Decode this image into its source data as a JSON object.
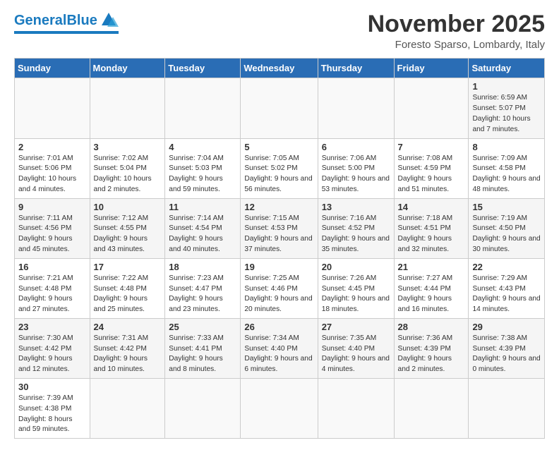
{
  "header": {
    "logo_general": "General",
    "logo_blue": "Blue",
    "month_title": "November 2025",
    "location": "Foresto Sparso, Lombardy, Italy"
  },
  "weekdays": [
    "Sunday",
    "Monday",
    "Tuesday",
    "Wednesday",
    "Thursday",
    "Friday",
    "Saturday"
  ],
  "weeks": [
    [
      {
        "day": "",
        "info": ""
      },
      {
        "day": "",
        "info": ""
      },
      {
        "day": "",
        "info": ""
      },
      {
        "day": "",
        "info": ""
      },
      {
        "day": "",
        "info": ""
      },
      {
        "day": "",
        "info": ""
      },
      {
        "day": "1",
        "info": "Sunrise: 6:59 AM\nSunset: 5:07 PM\nDaylight: 10 hours and 7 minutes."
      }
    ],
    [
      {
        "day": "2",
        "info": "Sunrise: 7:01 AM\nSunset: 5:06 PM\nDaylight: 10 hours and 4 minutes."
      },
      {
        "day": "3",
        "info": "Sunrise: 7:02 AM\nSunset: 5:04 PM\nDaylight: 10 hours and 2 minutes."
      },
      {
        "day": "4",
        "info": "Sunrise: 7:04 AM\nSunset: 5:03 PM\nDaylight: 9 hours and 59 minutes."
      },
      {
        "day": "5",
        "info": "Sunrise: 7:05 AM\nSunset: 5:02 PM\nDaylight: 9 hours and 56 minutes."
      },
      {
        "day": "6",
        "info": "Sunrise: 7:06 AM\nSunset: 5:00 PM\nDaylight: 9 hours and 53 minutes."
      },
      {
        "day": "7",
        "info": "Sunrise: 7:08 AM\nSunset: 4:59 PM\nDaylight: 9 hours and 51 minutes."
      },
      {
        "day": "8",
        "info": "Sunrise: 7:09 AM\nSunset: 4:58 PM\nDaylight: 9 hours and 48 minutes."
      }
    ],
    [
      {
        "day": "9",
        "info": "Sunrise: 7:11 AM\nSunset: 4:56 PM\nDaylight: 9 hours and 45 minutes."
      },
      {
        "day": "10",
        "info": "Sunrise: 7:12 AM\nSunset: 4:55 PM\nDaylight: 9 hours and 43 minutes."
      },
      {
        "day": "11",
        "info": "Sunrise: 7:14 AM\nSunset: 4:54 PM\nDaylight: 9 hours and 40 minutes."
      },
      {
        "day": "12",
        "info": "Sunrise: 7:15 AM\nSunset: 4:53 PM\nDaylight: 9 hours and 37 minutes."
      },
      {
        "day": "13",
        "info": "Sunrise: 7:16 AM\nSunset: 4:52 PM\nDaylight: 9 hours and 35 minutes."
      },
      {
        "day": "14",
        "info": "Sunrise: 7:18 AM\nSunset: 4:51 PM\nDaylight: 9 hours and 32 minutes."
      },
      {
        "day": "15",
        "info": "Sunrise: 7:19 AM\nSunset: 4:50 PM\nDaylight: 9 hours and 30 minutes."
      }
    ],
    [
      {
        "day": "16",
        "info": "Sunrise: 7:21 AM\nSunset: 4:48 PM\nDaylight: 9 hours and 27 minutes."
      },
      {
        "day": "17",
        "info": "Sunrise: 7:22 AM\nSunset: 4:48 PM\nDaylight: 9 hours and 25 minutes."
      },
      {
        "day": "18",
        "info": "Sunrise: 7:23 AM\nSunset: 4:47 PM\nDaylight: 9 hours and 23 minutes."
      },
      {
        "day": "19",
        "info": "Sunrise: 7:25 AM\nSunset: 4:46 PM\nDaylight: 9 hours and 20 minutes."
      },
      {
        "day": "20",
        "info": "Sunrise: 7:26 AM\nSunset: 4:45 PM\nDaylight: 9 hours and 18 minutes."
      },
      {
        "day": "21",
        "info": "Sunrise: 7:27 AM\nSunset: 4:44 PM\nDaylight: 9 hours and 16 minutes."
      },
      {
        "day": "22",
        "info": "Sunrise: 7:29 AM\nSunset: 4:43 PM\nDaylight: 9 hours and 14 minutes."
      }
    ],
    [
      {
        "day": "23",
        "info": "Sunrise: 7:30 AM\nSunset: 4:42 PM\nDaylight: 9 hours and 12 minutes."
      },
      {
        "day": "24",
        "info": "Sunrise: 7:31 AM\nSunset: 4:42 PM\nDaylight: 9 hours and 10 minutes."
      },
      {
        "day": "25",
        "info": "Sunrise: 7:33 AM\nSunset: 4:41 PM\nDaylight: 9 hours and 8 minutes."
      },
      {
        "day": "26",
        "info": "Sunrise: 7:34 AM\nSunset: 4:40 PM\nDaylight: 9 hours and 6 minutes."
      },
      {
        "day": "27",
        "info": "Sunrise: 7:35 AM\nSunset: 4:40 PM\nDaylight: 9 hours and 4 minutes."
      },
      {
        "day": "28",
        "info": "Sunrise: 7:36 AM\nSunset: 4:39 PM\nDaylight: 9 hours and 2 minutes."
      },
      {
        "day": "29",
        "info": "Sunrise: 7:38 AM\nSunset: 4:39 PM\nDaylight: 9 hours and 0 minutes."
      }
    ],
    [
      {
        "day": "30",
        "info": "Sunrise: 7:39 AM\nSunset: 4:38 PM\nDaylight: 8 hours and 59 minutes."
      },
      {
        "day": "",
        "info": ""
      },
      {
        "day": "",
        "info": ""
      },
      {
        "day": "",
        "info": ""
      },
      {
        "day": "",
        "info": ""
      },
      {
        "day": "",
        "info": ""
      },
      {
        "day": "",
        "info": ""
      }
    ]
  ]
}
